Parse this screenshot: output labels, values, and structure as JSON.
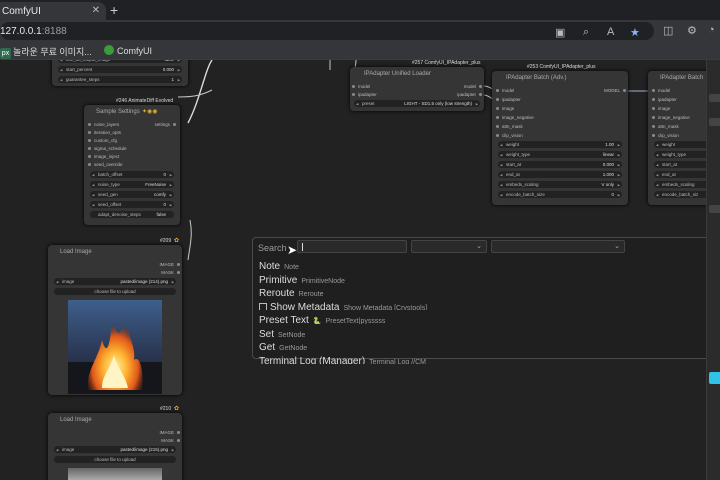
{
  "browser": {
    "tab_title": "ComfyUI",
    "new_tab": "+",
    "close": "✕",
    "url_host": "127.0.0.1",
    "url_port": ":8188",
    "bookmarks": [
      {
        "badge": "px",
        "label": "놀라운 무료 이미지..."
      },
      {
        "label": "ComfyUI"
      }
    ]
  },
  "nodes": {
    "top_left": {
      "widget_top_label": "use_as_output_image",
      "widget_top_value": "false",
      "start_percent_label": "start_percent",
      "start_percent_value": "0.000",
      "guarantee_label": "guarantee_steps",
      "guarantee_value": "1"
    },
    "sample_settings": {
      "id": "#246 AnimateDiff Evolved",
      "title": "Sample Settings",
      "output": "settings",
      "inputs": [
        "noise_layers",
        "iteration_opts",
        "custom_cfg",
        "sigma_schedule",
        "image_inject",
        "seed_override"
      ],
      "batch_offset_label": "batch_offset",
      "batch_offset_value": "0",
      "noise_type_label": "noise_type",
      "noise_type_value": "FreeNoise",
      "seed_gen_label": "seed_gen",
      "seed_gen_value": "comfy",
      "seed_offset_label": "seed_offset",
      "seed_offset_value": "0",
      "adapt_label": "adapt_denoise_steps",
      "adapt_value": "false"
    },
    "ipa_loader": {
      "id": "#257 ComfyUI_IPAdapter_plus",
      "title": "IPAdapter Unified Loader",
      "input_model": "model",
      "input_ipadapter": "ipadapter",
      "output_model": "model",
      "output_ipadapter": "ipadapter",
      "preset_label": "preset",
      "preset_value": "LIGHT - SD1.5 only (low strength)"
    },
    "ipa_batch": {
      "id": "#253 ComfyUI_IPAdapter_plus",
      "title": "IPAdapter Batch (Adv.)",
      "output": "MODEL",
      "inputs": [
        "model",
        "ipadapter",
        "image",
        "image_negative",
        "attn_mask",
        "clip_vision"
      ],
      "widgets": [
        {
          "label": "weight",
          "value": "1.00"
        },
        {
          "label": "weight_type",
          "value": "linear"
        },
        {
          "label": "start_at",
          "value": "0.000"
        },
        {
          "label": "end_at",
          "value": "1.000"
        },
        {
          "label": "embeds_scaling",
          "value": "V only"
        },
        {
          "label": "encode_batch_size",
          "value": "0"
        }
      ]
    },
    "ipa_batch2": {
      "title": "IPAdapter Batch",
      "inputs": [
        "model",
        "ipadapter",
        "image",
        "image_negative",
        "attn_mask",
        "clip_vision"
      ],
      "widgets": [
        "weight",
        "weight_type",
        "start_at",
        "end_at",
        "embeds_scaling",
        "encode_batch_siz"
      ]
    },
    "load_image_1": {
      "id": "#209",
      "title": "Load Image",
      "out_image": "IMAGE",
      "out_mask": "MASK",
      "image_label": "image",
      "image_value": "pasted/image (214).png",
      "upload": "choose file to upload"
    },
    "load_image_2": {
      "id": "#210",
      "title": "Load Image",
      "out_image": "IMAGE",
      "out_mask": "MASK",
      "image_label": "image",
      "image_value": "pasted/image (215).png",
      "upload": "choose file to upload"
    }
  },
  "search": {
    "label": "Search",
    "input_value": "",
    "results": [
      {
        "name": "Note",
        "class": "Note"
      },
      {
        "name": "Primitive",
        "class": "PrimitiveNode"
      },
      {
        "name": "Reroute",
        "class": "Reroute"
      },
      {
        "name": "Show Metadata",
        "class": "Show Metadata [Crystools]",
        "checkbox": true
      },
      {
        "name": "Preset Text",
        "class": "PresetText|pysssss",
        "python_icon": true
      },
      {
        "name": "Set",
        "class": "SetNode"
      },
      {
        "name": "Get",
        "class": "GetNode"
      },
      {
        "name": "Terminal Log (Manager)",
        "class": "Terminal Log //CM"
      }
    ]
  },
  "colors": {
    "canvas_bg": "#222222",
    "node_bg": "#353535",
    "accent_cyan": "#2ec4e6",
    "link_blue": "#4a90d9"
  }
}
